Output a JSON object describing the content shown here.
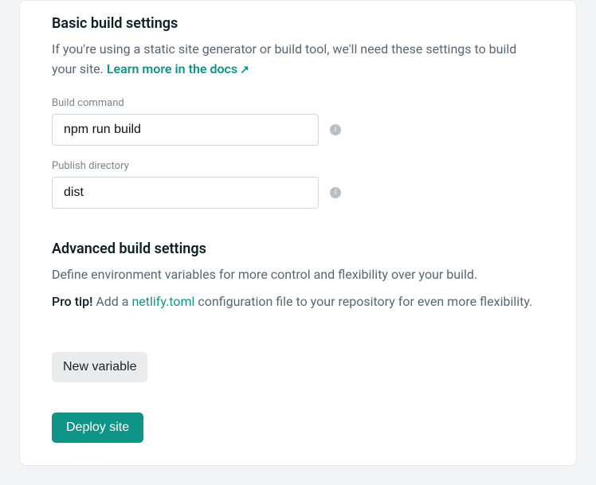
{
  "basic": {
    "title": "Basic build settings",
    "description": "If you're using a static site generator or build tool, we'll need these settings to build your site. ",
    "docs_link": "Learn more in the docs",
    "docs_arrow": "↗",
    "build_command": {
      "label": "Build command",
      "value": "npm run build",
      "info_glyph": "i"
    },
    "publish_directory": {
      "label": "Publish directory",
      "value": "dist",
      "info_glyph": "i"
    }
  },
  "advanced": {
    "title": "Advanced build settings",
    "description": "Define environment variables for more control and flexibility over your build.",
    "pro_tip_label": "Pro tip!",
    "pro_tip_prefix": " Add a ",
    "pro_tip_link": "netlify.toml",
    "pro_tip_suffix": " configuration file to your repository for even more flexibility.",
    "new_variable_label": "New variable"
  },
  "deploy_label": "Deploy site"
}
